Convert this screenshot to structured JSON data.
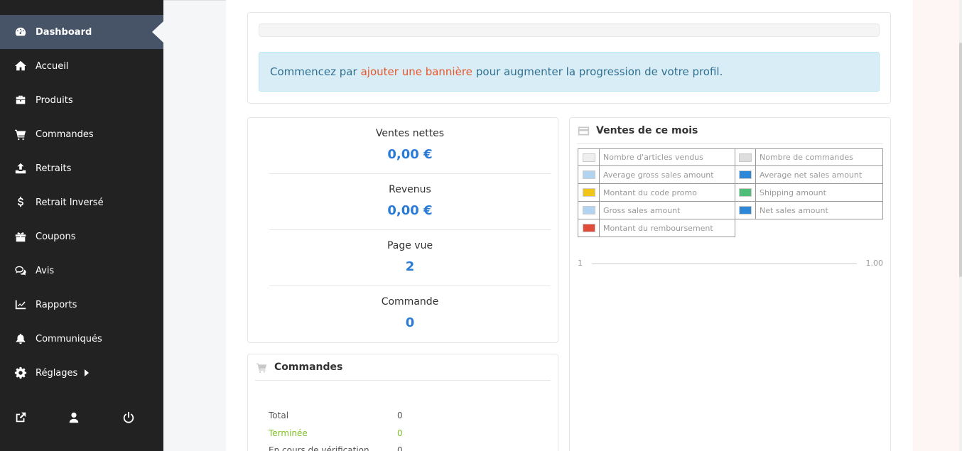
{
  "sidebar": {
    "items": [
      {
        "label": "Dashboard",
        "icon": "tachometer-icon",
        "active": true
      },
      {
        "label": "Accueil",
        "icon": "home-icon"
      },
      {
        "label": "Produits",
        "icon": "briefcase-icon"
      },
      {
        "label": "Commandes",
        "icon": "shopping-cart-icon"
      },
      {
        "label": "Retraits",
        "icon": "upload-icon"
      },
      {
        "label": "Retrait Inversé",
        "icon": "dollar-icon"
      },
      {
        "label": "Coupons",
        "icon": "gift-icon"
      },
      {
        "label": "Avis",
        "icon": "comments-icon"
      },
      {
        "label": "Rapports",
        "icon": "chart-line-icon"
      },
      {
        "label": "Communiqués",
        "icon": "bell-icon"
      },
      {
        "label": "Réglages",
        "icon": "cog-icon"
      }
    ],
    "footer_icons": [
      "external-link-icon",
      "user-icon",
      "power-icon"
    ]
  },
  "profile": {
    "progress_percent": 0,
    "message_before": "Commencez par",
    "message_link": "ajouter une bannière",
    "message_after": "pour augmenter la progression de votre profil."
  },
  "stats": [
    {
      "label": "Ventes nettes",
      "value": "0,00 €"
    },
    {
      "label": "Revenus",
      "value": "0,00 €"
    },
    {
      "label": "Page vue",
      "value": "2"
    },
    {
      "label": "Commande",
      "value": "0"
    }
  ],
  "orders": {
    "title": "Commandes",
    "rows": [
      {
        "label": "Total",
        "value": "0"
      },
      {
        "label": "Terminée",
        "value": "0"
      },
      {
        "label": "En cours de vérification",
        "value": "0"
      }
    ]
  },
  "sales": {
    "title": "Ventes de ce mois",
    "legend": [
      {
        "label": "Nombre d'articles vendus",
        "color": "#eeeeee"
      },
      {
        "label": "Nombre de commandes",
        "color": "#dddddd"
      },
      {
        "label": "Average gross sales amount",
        "color": "#b3d4f0"
      },
      {
        "label": "Average net sales amount",
        "color": "#2e88d8"
      },
      {
        "label": "Montant du code promo",
        "color": "#f0c419"
      },
      {
        "label": "Shipping amount",
        "color": "#4fbe79"
      },
      {
        "label": "Gross sales amount",
        "color": "#b3d4f0"
      },
      {
        "label": "Net sales amount",
        "color": "#2e88d8"
      },
      {
        "label": "Montant du remboursement",
        "color": "#e04b3a"
      }
    ],
    "axis_min": "1",
    "axis_max": "1.00"
  },
  "colors": {
    "sidebar_bg": "#222222",
    "active_bg": "#475467",
    "accent_blue": "#2b7bd6",
    "link_orange": "#e8562a",
    "info_bg": "#d9edf7",
    "success_green": "#7fbf2a"
  }
}
